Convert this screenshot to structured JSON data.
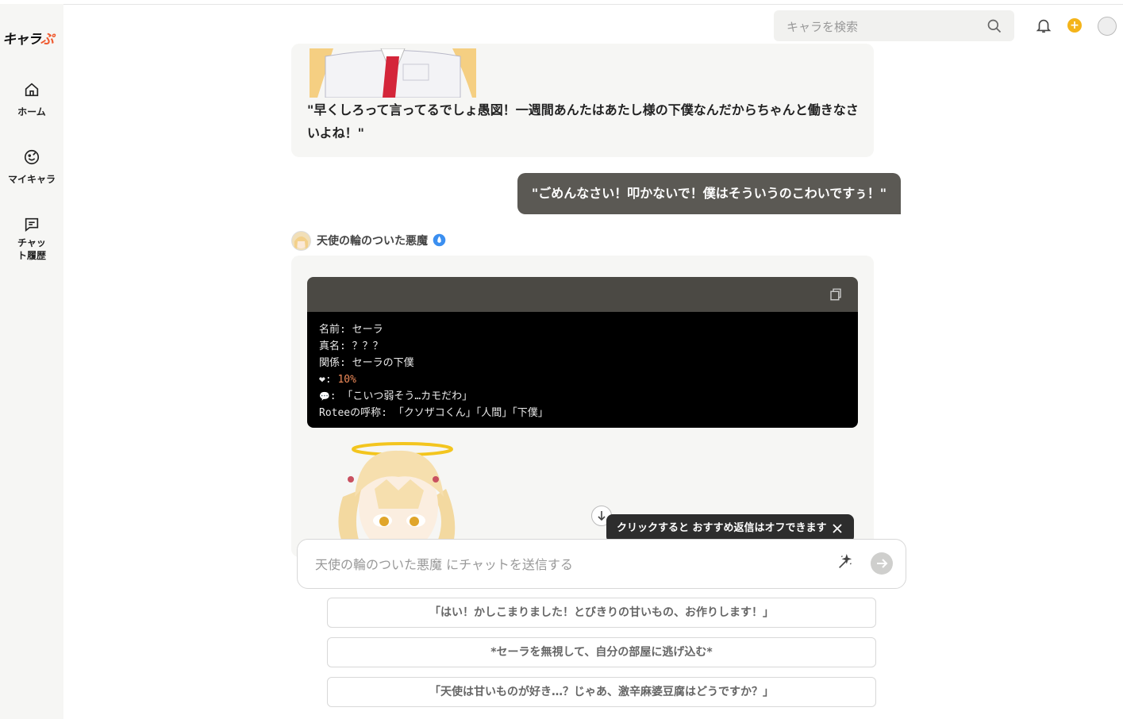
{
  "app": {
    "logo_main": "キャラ",
    "logo_accent": "ぷ"
  },
  "sidebar": {
    "items": [
      {
        "label": "ホーム",
        "icon": "home-icon"
      },
      {
        "label": "マイキャラ",
        "icon": "my-chara-icon"
      },
      {
        "label": "チャット履歴",
        "icon": "chat-history-icon"
      }
    ]
  },
  "header": {
    "search_placeholder": "キャラを検索",
    "coin_symbol": "+"
  },
  "chat": {
    "ai_message_1": "\"早くしろって言ってるでしょ愚図！一週間あんたはあたし様の下僕なんだからちゃんと働きなさいよね！\"",
    "user_message_1": "\"ごめんなさい！叩かないで！僕はそういうのこわいですぅ！\"",
    "character_name": "天使の輪のついた悪魔",
    "status_block": {
      "line1": "名前: セーラ",
      "line2": "真名: ？？？",
      "line3": "関係: セーラの下僕",
      "affection_icon": "❤",
      "affection_sep": ": ",
      "affection_value": "10%",
      "thought_icon": "💬",
      "thought_text": ": 「こいつ弱そう…カモだわ」",
      "line6": "Roteeの呼称: 「クソザコくん」「人間」「下僕」"
    }
  },
  "tooltip": {
    "text": "クリックすると おすすめ返信はオフできます"
  },
  "composer": {
    "placeholder": "天使の輪のついた悪魔 にチャットを送信する"
  },
  "suggestions": [
    "「はい！かしこまりました！とびきりの甘いもの、お作りします！」",
    "*セーラを無視して、自分の部屋に逃げ込む*",
    "「天使は甘いものが好き…？じゃあ、激辛麻婆豆腐はどうですか？」"
  ],
  "colors": {
    "accent": "#ef5a2f",
    "user_bubble": "#5b5954",
    "coin": "#f4b41a",
    "verified": "#3b8ff0"
  }
}
